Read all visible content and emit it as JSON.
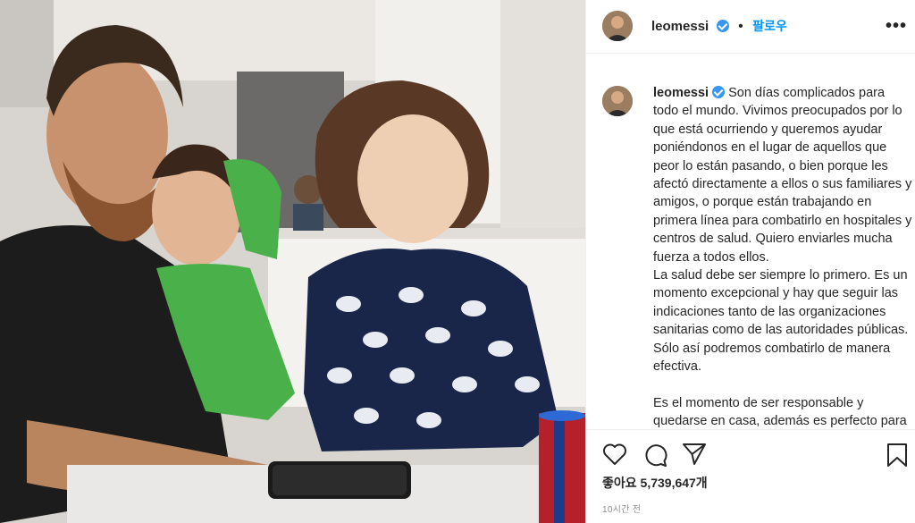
{
  "post": {
    "username": "leomessi",
    "follow_label": "팔로우",
    "more_label": "•••",
    "caption": {
      "username": "leomessi",
      "text": "Son días complicados para todo el mundo. Vivimos preocupados por lo que está ocurriendo y queremos ayudar poniéndonos en el lugar de aquellos que peor lo están pasando, o bien porque les afectó directamente a ellos o sus familiares y amigos, o porque están trabajando en primera línea para combatirlo en hospitales y centros de salud. Quiero enviarles mucha fuerza a todos ellos.\nLa salud debe ser siempre lo primero. Es un momento excepcional y hay que seguir las indicaciones tanto de las organizaciones sanitarias como de las autoridades públicas. Sólo así podremos combatirlo de manera efectiva.\n\nEs el momento de ser responsable y quedarse en casa, además es perfecto para"
    },
    "likes_text": "좋아요 5,739,647개",
    "time_text": "10시간 전"
  },
  "icons": {
    "like": "heart-icon",
    "comment": "comment-icon",
    "share": "share-icon",
    "save": "bookmark-icon",
    "verified": "verified-badge-icon"
  },
  "colors": {
    "accent": "#0095f6",
    "verified": "#3897f0",
    "text": "#262626",
    "muted": "#8e8e8e"
  }
}
